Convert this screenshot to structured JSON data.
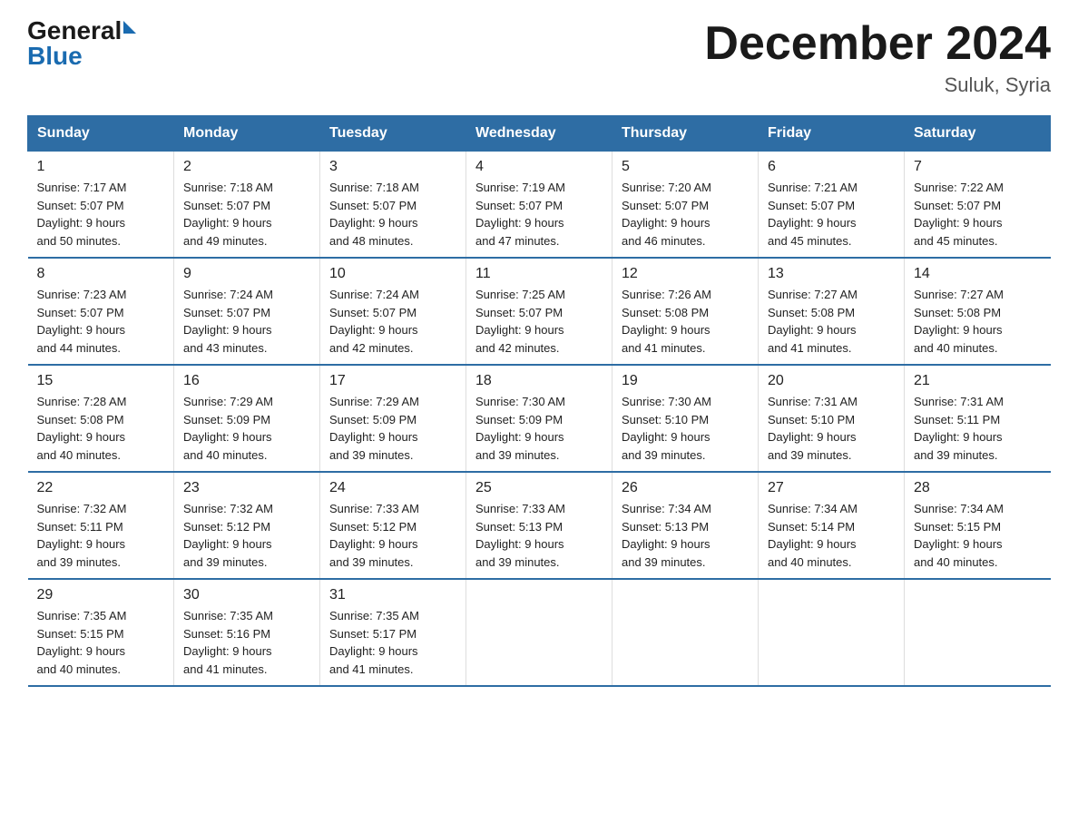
{
  "header": {
    "logo_general": "General",
    "logo_blue": "Blue",
    "title": "December 2024",
    "subtitle": "Suluk, Syria"
  },
  "days_of_week": [
    "Sunday",
    "Monday",
    "Tuesday",
    "Wednesday",
    "Thursday",
    "Friday",
    "Saturday"
  ],
  "weeks": [
    [
      {
        "num": "1",
        "sunrise": "7:17 AM",
        "sunset": "5:07 PM",
        "daylight": "9 hours and 50 minutes."
      },
      {
        "num": "2",
        "sunrise": "7:18 AM",
        "sunset": "5:07 PM",
        "daylight": "9 hours and 49 minutes."
      },
      {
        "num": "3",
        "sunrise": "7:18 AM",
        "sunset": "5:07 PM",
        "daylight": "9 hours and 48 minutes."
      },
      {
        "num": "4",
        "sunrise": "7:19 AM",
        "sunset": "5:07 PM",
        "daylight": "9 hours and 47 minutes."
      },
      {
        "num": "5",
        "sunrise": "7:20 AM",
        "sunset": "5:07 PM",
        "daylight": "9 hours and 46 minutes."
      },
      {
        "num": "6",
        "sunrise": "7:21 AM",
        "sunset": "5:07 PM",
        "daylight": "9 hours and 45 minutes."
      },
      {
        "num": "7",
        "sunrise": "7:22 AM",
        "sunset": "5:07 PM",
        "daylight": "9 hours and 45 minutes."
      }
    ],
    [
      {
        "num": "8",
        "sunrise": "7:23 AM",
        "sunset": "5:07 PM",
        "daylight": "9 hours and 44 minutes."
      },
      {
        "num": "9",
        "sunrise": "7:24 AM",
        "sunset": "5:07 PM",
        "daylight": "9 hours and 43 minutes."
      },
      {
        "num": "10",
        "sunrise": "7:24 AM",
        "sunset": "5:07 PM",
        "daylight": "9 hours and 42 minutes."
      },
      {
        "num": "11",
        "sunrise": "7:25 AM",
        "sunset": "5:07 PM",
        "daylight": "9 hours and 42 minutes."
      },
      {
        "num": "12",
        "sunrise": "7:26 AM",
        "sunset": "5:08 PM",
        "daylight": "9 hours and 41 minutes."
      },
      {
        "num": "13",
        "sunrise": "7:27 AM",
        "sunset": "5:08 PM",
        "daylight": "9 hours and 41 minutes."
      },
      {
        "num": "14",
        "sunrise": "7:27 AM",
        "sunset": "5:08 PM",
        "daylight": "9 hours and 40 minutes."
      }
    ],
    [
      {
        "num": "15",
        "sunrise": "7:28 AM",
        "sunset": "5:08 PM",
        "daylight": "9 hours and 40 minutes."
      },
      {
        "num": "16",
        "sunrise": "7:29 AM",
        "sunset": "5:09 PM",
        "daylight": "9 hours and 40 minutes."
      },
      {
        "num": "17",
        "sunrise": "7:29 AM",
        "sunset": "5:09 PM",
        "daylight": "9 hours and 39 minutes."
      },
      {
        "num": "18",
        "sunrise": "7:30 AM",
        "sunset": "5:09 PM",
        "daylight": "9 hours and 39 minutes."
      },
      {
        "num": "19",
        "sunrise": "7:30 AM",
        "sunset": "5:10 PM",
        "daylight": "9 hours and 39 minutes."
      },
      {
        "num": "20",
        "sunrise": "7:31 AM",
        "sunset": "5:10 PM",
        "daylight": "9 hours and 39 minutes."
      },
      {
        "num": "21",
        "sunrise": "7:31 AM",
        "sunset": "5:11 PM",
        "daylight": "9 hours and 39 minutes."
      }
    ],
    [
      {
        "num": "22",
        "sunrise": "7:32 AM",
        "sunset": "5:11 PM",
        "daylight": "9 hours and 39 minutes."
      },
      {
        "num": "23",
        "sunrise": "7:32 AM",
        "sunset": "5:12 PM",
        "daylight": "9 hours and 39 minutes."
      },
      {
        "num": "24",
        "sunrise": "7:33 AM",
        "sunset": "5:12 PM",
        "daylight": "9 hours and 39 minutes."
      },
      {
        "num": "25",
        "sunrise": "7:33 AM",
        "sunset": "5:13 PM",
        "daylight": "9 hours and 39 minutes."
      },
      {
        "num": "26",
        "sunrise": "7:34 AM",
        "sunset": "5:13 PM",
        "daylight": "9 hours and 39 minutes."
      },
      {
        "num": "27",
        "sunrise": "7:34 AM",
        "sunset": "5:14 PM",
        "daylight": "9 hours and 40 minutes."
      },
      {
        "num": "28",
        "sunrise": "7:34 AM",
        "sunset": "5:15 PM",
        "daylight": "9 hours and 40 minutes."
      }
    ],
    [
      {
        "num": "29",
        "sunrise": "7:35 AM",
        "sunset": "5:15 PM",
        "daylight": "9 hours and 40 minutes."
      },
      {
        "num": "30",
        "sunrise": "7:35 AM",
        "sunset": "5:16 PM",
        "daylight": "9 hours and 41 minutes."
      },
      {
        "num": "31",
        "sunrise": "7:35 AM",
        "sunset": "5:17 PM",
        "daylight": "9 hours and 41 minutes."
      },
      null,
      null,
      null,
      null
    ]
  ]
}
